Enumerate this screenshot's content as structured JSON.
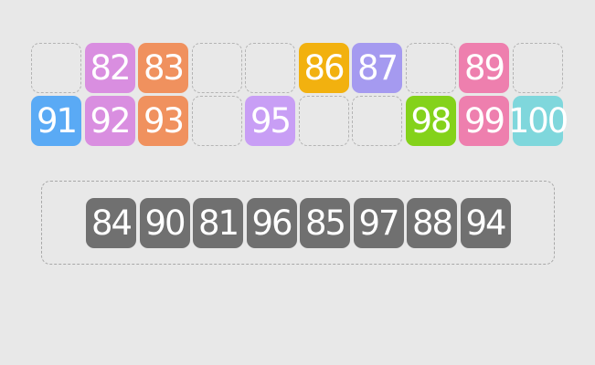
{
  "board": {
    "rows": [
      [
        {
          "label": "",
          "color": ""
        },
        {
          "label": "82",
          "color": "#d98ee0"
        },
        {
          "label": "83",
          "color": "#f0915e"
        },
        {
          "label": "",
          "color": ""
        },
        {
          "label": "",
          "color": ""
        },
        {
          "label": "86",
          "color": "#f2b10f"
        },
        {
          "label": "87",
          "color": "#a59af0"
        },
        {
          "label": "",
          "color": ""
        },
        {
          "label": "89",
          "color": "#ee7fae"
        },
        {
          "label": "",
          "color": ""
        }
      ],
      [
        {
          "label": "91",
          "color": "#5aaaf5"
        },
        {
          "label": "92",
          "color": "#d98ee0"
        },
        {
          "label": "93",
          "color": "#f0915e"
        },
        {
          "label": "",
          "color": ""
        },
        {
          "label": "95",
          "color": "#c89ef5"
        },
        {
          "label": "",
          "color": ""
        },
        {
          "label": "",
          "color": ""
        },
        {
          "label": "98",
          "color": "#84d21a"
        },
        {
          "label": "99",
          "color": "#ee7fae"
        },
        {
          "label": "100",
          "color": "#7fd7dc"
        }
      ]
    ]
  },
  "tray": {
    "tiles": [
      "84",
      "90",
      "81",
      "96",
      "85",
      "97",
      "88",
      "94"
    ],
    "tile_color": "#707070"
  }
}
